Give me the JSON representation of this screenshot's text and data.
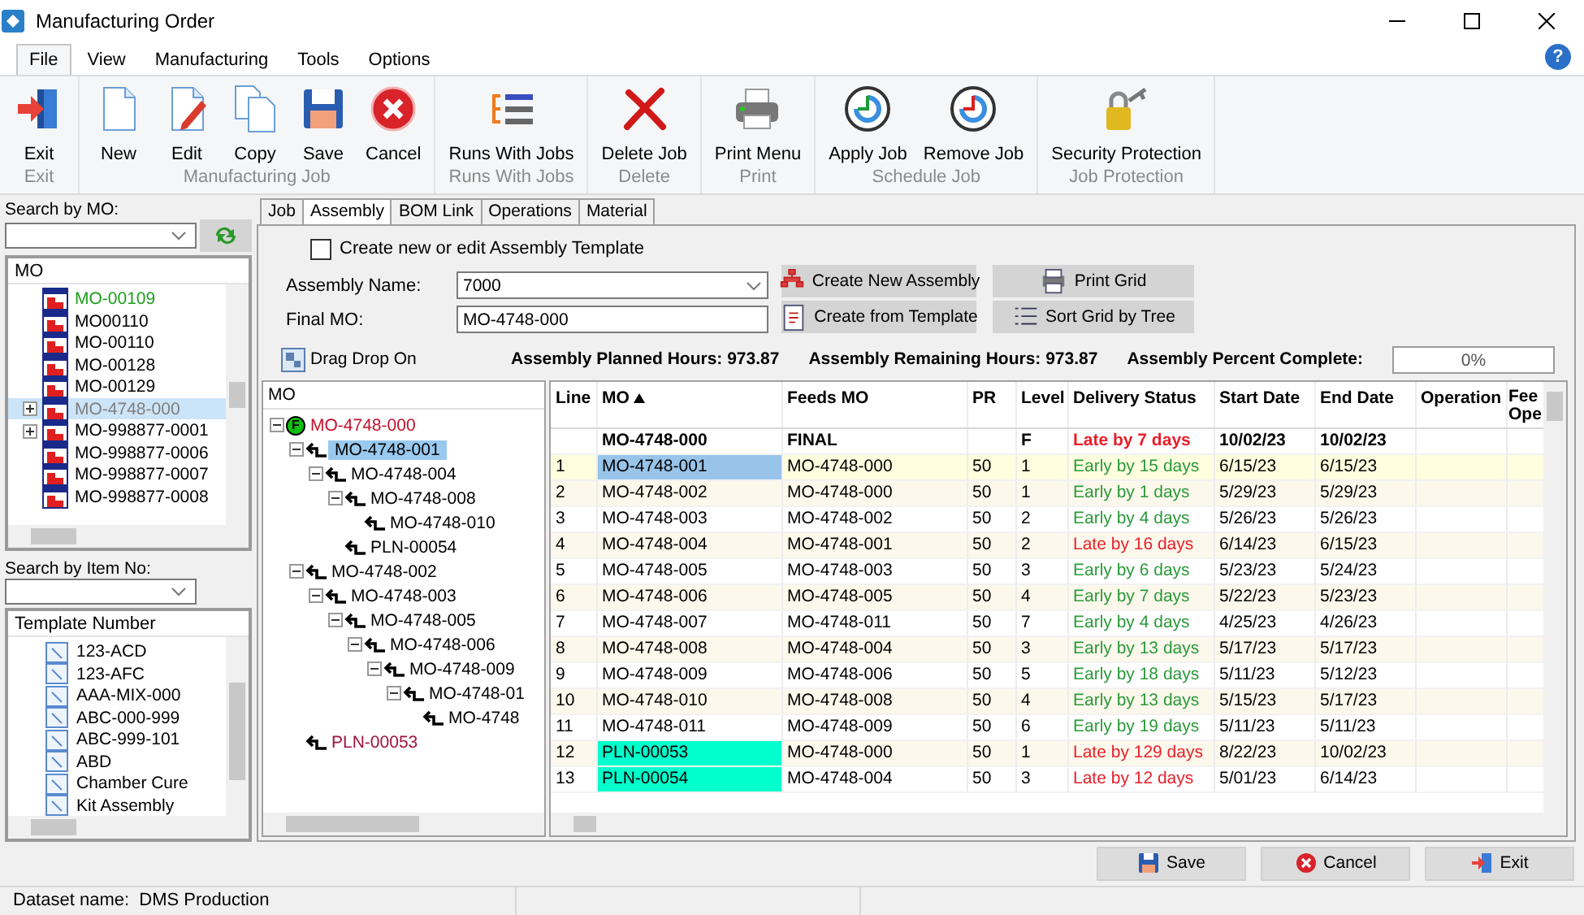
{
  "window": {
    "title": "Manufacturing Order",
    "help": "?"
  },
  "menu": [
    {
      "label": "File",
      "selected": true
    },
    {
      "label": "View",
      "selected": false
    },
    {
      "label": "Manufacturing",
      "selected": false
    },
    {
      "label": "Tools",
      "selected": false
    },
    {
      "label": "Options",
      "selected": false
    }
  ],
  "ribbon": [
    {
      "group": "Exit",
      "buttons": [
        "Exit"
      ]
    },
    {
      "group": "Manufacturing Job",
      "buttons": [
        "New",
        "Edit",
        "Copy",
        "Save",
        "Cancel"
      ]
    },
    {
      "group": "Runs With Jobs",
      "buttons": [
        "Runs With Jobs"
      ]
    },
    {
      "group": "Delete",
      "buttons": [
        "Delete Job"
      ]
    },
    {
      "group": "Print",
      "buttons": [
        "Print Menu"
      ]
    },
    {
      "group": "Schedule Job",
      "buttons": [
        "Apply Job",
        "Remove Job"
      ]
    },
    {
      "group": "Job Protection",
      "buttons": [
        "Security Protection"
      ]
    }
  ],
  "left": {
    "search_mo": {
      "label": "Search by MO:"
    },
    "mo_list": {
      "header": "MO",
      "items": [
        {
          "label": "MO-00109",
          "color": "#1e9e1e",
          "expandable": false,
          "selected": false
        },
        {
          "label": "MO00110",
          "color": "#000000",
          "expandable": false,
          "selected": false
        },
        {
          "label": "MO-00110",
          "color": "#000000",
          "expandable": false,
          "selected": false
        },
        {
          "label": "MO-00128",
          "color": "#000000",
          "expandable": false,
          "selected": false
        },
        {
          "label": "MO-00129",
          "color": "#000000",
          "expandable": false,
          "selected": false
        },
        {
          "label": "MO-4748-000",
          "color": "#808080",
          "expandable": true,
          "selected": true
        },
        {
          "label": "MO-998877-0001",
          "color": "#000000",
          "expandable": true,
          "selected": false
        },
        {
          "label": "MO-998877-0006",
          "color": "#000000",
          "expandable": false,
          "selected": false
        },
        {
          "label": "MO-998877-0007",
          "color": "#000000",
          "expandable": false,
          "selected": false
        },
        {
          "label": "MO-998877-0008",
          "color": "#000000",
          "expandable": false,
          "selected": false
        }
      ]
    },
    "search_item": {
      "label": "Search by Item No:"
    },
    "templates": {
      "header": "Template Number",
      "items": [
        "123-ACD",
        "123-AFC",
        "AAA-MIX-000",
        "ABC-000-999",
        "ABC-999-101",
        "ABD",
        "Chamber Cure",
        "Kit Assembly"
      ]
    }
  },
  "tabs": [
    {
      "label": "Job",
      "selected": false
    },
    {
      "label": "Assembly",
      "selected": true
    },
    {
      "label": "BOM Link",
      "selected": false
    },
    {
      "label": "Operations",
      "selected": false
    },
    {
      "label": "Material",
      "selected": false
    }
  ],
  "assembly": {
    "template_checkbox": {
      "label": "Create new or edit Assembly Template",
      "checked": false
    },
    "assembly_name": {
      "label": "Assembly Name:",
      "value": "7000"
    },
    "final_mo": {
      "label": "Final MO:",
      "value": "MO-4748-000"
    },
    "buttons": [
      "Create New Assembly",
      "Print Grid",
      "Create from Template",
      "Sort Grid by Tree"
    ],
    "drag_drop": "Drag Drop On",
    "planned_hours": {
      "label": "Assembly Planned Hours:",
      "value": "973.87"
    },
    "remaining_hours": {
      "label": "Assembly Remaining Hours:",
      "value": "973.87"
    },
    "percent_complete": {
      "label": "Assembly Percent Complete:",
      "reading": "0%",
      "level": 0
    }
  },
  "tree": {
    "header": "MO",
    "nodes": [
      {
        "label": "MO-4748-000",
        "color": "#c8102e",
        "badge": "F",
        "expanded": true,
        "selected": false,
        "children": [
          {
            "label": "MO-4748-001",
            "expanded": true,
            "selected": true,
            "children": [
              {
                "label": "MO-4748-004",
                "color": "#000000",
                "expanded": true,
                "selected": false,
                "children": [
                  {
                    "label": "MO-4748-008",
                    "color": "#000000",
                    "expanded": true,
                    "selected": false,
                    "children": [
                      {
                        "label": "MO-4748-010",
                        "color": "#000000",
                        "selected": false
                      }
                    ]
                  },
                  {
                    "label": "PLN-00054",
                    "color": "#000000",
                    "selected": false
                  }
                ]
              }
            ]
          },
          {
            "label": "MO-4748-002",
            "color": "#000000",
            "expanded": true,
            "selected": false,
            "children": [
              {
                "label": "MO-4748-003",
                "color": "#000000",
                "expanded": true,
                "selected": false,
                "children": [
                  {
                    "label": "MO-4748-005",
                    "color": "#000000",
                    "expanded": true,
                    "selected": false,
                    "children": [
                      {
                        "label": "MO-4748-006",
                        "color": "#000000",
                        "expanded": true,
                        "selected": false,
                        "children": [
                          {
                            "label": "MO-4748-009",
                            "color": "#000000",
                            "expanded": true,
                            "selected": false,
                            "children": [
                              {
                                "label": "MO-4748-01",
                                "color": "#000000",
                                "expanded": true,
                                "selected": false,
                                "children": [
                                  {
                                    "label": "MO-4748",
                                    "color": "#000000",
                                    "selected": false
                                  }
                                ]
                              }
                            ]
                          }
                        ]
                      }
                    ]
                  }
                ]
              }
            ]
          },
          {
            "label": "PLN-00053",
            "color": "#a0143c",
            "selected": false
          }
        ]
      }
    ]
  },
  "grid": {
    "columns": [
      {
        "label": "Line",
        "sorted": false
      },
      {
        "label": "MO",
        "sorted": true
      },
      {
        "label": "Feeds MO",
        "sorted": false
      },
      {
        "label": "PR",
        "sorted": false
      },
      {
        "label": "Level",
        "sorted": false
      },
      {
        "label": "Delivery Status",
        "sorted": false
      },
      {
        "label": "Start Date",
        "sorted": false
      },
      {
        "label": "End Date",
        "sorted": false
      },
      {
        "label": "Operation",
        "sorted": false
      },
      {
        "label": "Fee Ope",
        "sorted": false
      }
    ],
    "summary": {
      "mo": "MO-4748-000",
      "feeds_mo": "FINAL",
      "bom_level": "F",
      "delivery_status": "Late by 7 days",
      "late": true,
      "start_date": "10/02/23",
      "end_date": "10/02/23"
    },
    "rows": [
      {
        "line": "1",
        "mo": "MO-4748-001",
        "feeds_mo": "MO-4748-000",
        "pr": "50",
        "bom_level": "1",
        "delivery_status": "Early by 15 days",
        "late": false,
        "start_date": "6/15/23",
        "end_date": "6/15/23",
        "selected": true,
        "planned": false
      },
      {
        "line": "2",
        "mo": "MO-4748-002",
        "feeds_mo": "MO-4748-000",
        "pr": "50",
        "bom_level": "1",
        "delivery_status": "Early by 1 days",
        "late": false,
        "start_date": "5/29/23",
        "end_date": "5/29/23",
        "selected": false,
        "planned": false
      },
      {
        "line": "3",
        "mo": "MO-4748-003",
        "feeds_mo": "MO-4748-002",
        "pr": "50",
        "bom_level": "2",
        "delivery_status": "Early by 4 days",
        "late": false,
        "start_date": "5/26/23",
        "end_date": "5/26/23",
        "selected": false,
        "planned": false
      },
      {
        "line": "4",
        "mo": "MO-4748-004",
        "feeds_mo": "MO-4748-001",
        "pr": "50",
        "bom_level": "2",
        "delivery_status": "Late by 16 days",
        "late": true,
        "start_date": "6/14/23",
        "end_date": "6/15/23",
        "selected": false,
        "planned": false
      },
      {
        "line": "5",
        "mo": "MO-4748-005",
        "feeds_mo": "MO-4748-003",
        "pr": "50",
        "bom_level": "3",
        "delivery_status": "Early by 6 days",
        "late": false,
        "start_date": "5/23/23",
        "end_date": "5/24/23",
        "selected": false,
        "planned": false
      },
      {
        "line": "6",
        "mo": "MO-4748-006",
        "feeds_mo": "MO-4748-005",
        "pr": "50",
        "bom_level": "4",
        "delivery_status": "Early by 7 days",
        "late": false,
        "start_date": "5/22/23",
        "end_date": "5/23/23",
        "selected": false,
        "planned": false
      },
      {
        "line": "7",
        "mo": "MO-4748-007",
        "feeds_mo": "MO-4748-011",
        "pr": "50",
        "bom_level": "7",
        "delivery_status": "Early by 4 days",
        "late": false,
        "start_date": "4/25/23",
        "end_date": "4/26/23",
        "selected": false,
        "planned": false
      },
      {
        "line": "8",
        "mo": "MO-4748-008",
        "feeds_mo": "MO-4748-004",
        "pr": "50",
        "bom_level": "3",
        "delivery_status": "Early by 13 days",
        "late": false,
        "start_date": "5/17/23",
        "end_date": "5/17/23",
        "selected": false,
        "planned": false
      },
      {
        "line": "9",
        "mo": "MO-4748-009",
        "feeds_mo": "MO-4748-006",
        "pr": "50",
        "bom_level": "5",
        "delivery_status": "Early by 18 days",
        "late": false,
        "start_date": "5/11/23",
        "end_date": "5/12/23",
        "selected": false,
        "planned": false
      },
      {
        "line": "10",
        "mo": "MO-4748-010",
        "feeds_mo": "MO-4748-008",
        "pr": "50",
        "bom_level": "4",
        "delivery_status": "Early by 13 days",
        "late": false,
        "start_date": "5/15/23",
        "end_date": "5/17/23",
        "selected": false,
        "planned": false
      },
      {
        "line": "11",
        "mo": "MO-4748-011",
        "feeds_mo": "MO-4748-009",
        "pr": "50",
        "bom_level": "6",
        "delivery_status": "Early by 19 days",
        "late": false,
        "start_date": "5/11/23",
        "end_date": "5/11/23",
        "selected": false,
        "planned": false
      },
      {
        "line": "12",
        "mo": "PLN-00053",
        "feeds_mo": "MO-4748-000",
        "pr": "50",
        "bom_level": "1",
        "delivery_status": "Late by 129 days",
        "late": true,
        "start_date": "8/22/23",
        "end_date": "10/02/23",
        "selected": false,
        "planned": true
      },
      {
        "line": "13",
        "mo": "PLN-00054",
        "feeds_mo": "MO-4748-004",
        "pr": "50",
        "bom_level": "3",
        "delivery_status": "Late by 12 days",
        "late": true,
        "start_date": "5/01/23",
        "end_date": "6/14/23",
        "selected": false,
        "planned": true
      }
    ]
  },
  "footer_buttons": [
    "Save",
    "Cancel",
    "Exit"
  ],
  "status_bar": {
    "dataset": "Dataset name:  DMS Production"
  }
}
